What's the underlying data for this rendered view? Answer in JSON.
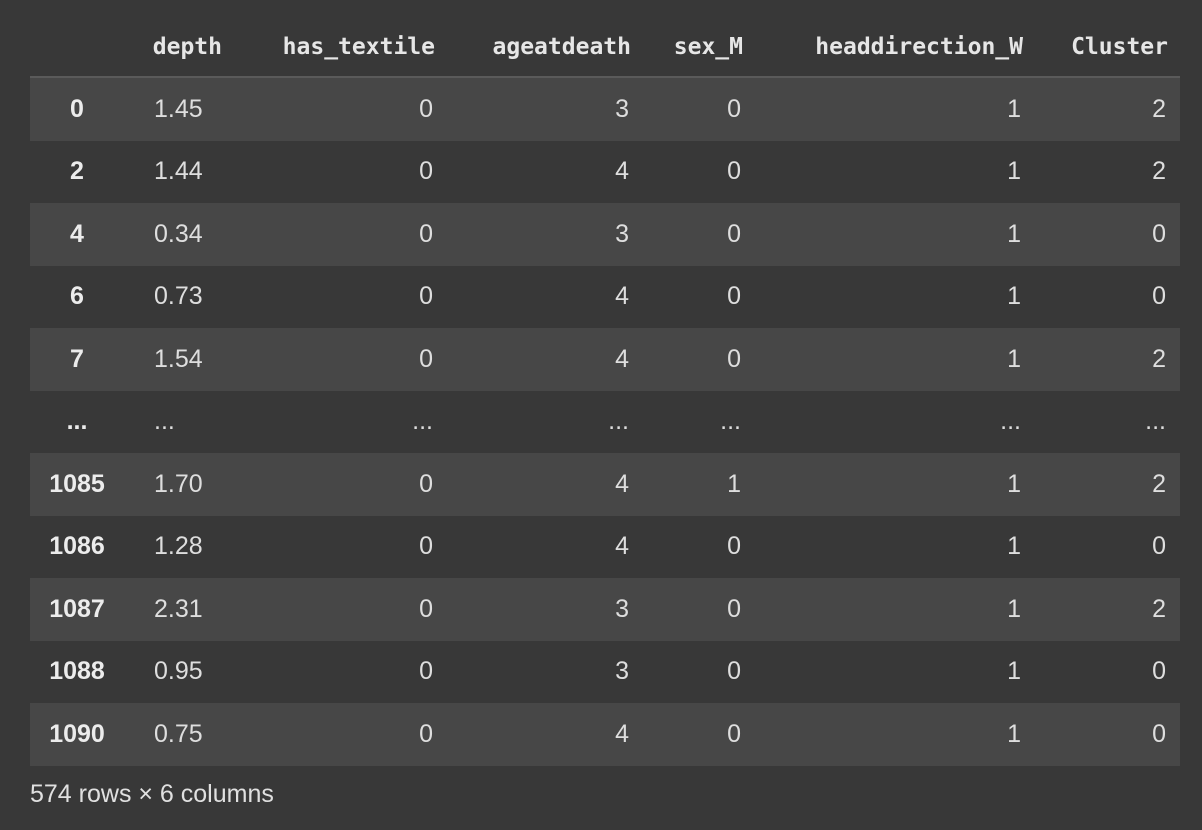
{
  "table": {
    "columns": [
      "depth",
      "has_textile",
      "ageatdeath",
      "sex_M",
      "headdirection_W",
      "Cluster"
    ],
    "rows": [
      {
        "index": "0",
        "cells": [
          "1.45",
          "0",
          "3",
          "0",
          "1",
          "2"
        ]
      },
      {
        "index": "2",
        "cells": [
          "1.44",
          "0",
          "4",
          "0",
          "1",
          "2"
        ]
      },
      {
        "index": "4",
        "cells": [
          "0.34",
          "0",
          "3",
          "0",
          "1",
          "0"
        ]
      },
      {
        "index": "6",
        "cells": [
          "0.73",
          "0",
          "4",
          "0",
          "1",
          "0"
        ]
      },
      {
        "index": "7",
        "cells": [
          "1.54",
          "0",
          "4",
          "0",
          "1",
          "2"
        ]
      },
      {
        "index": "...",
        "cells": [
          "...",
          "...",
          "...",
          "...",
          "...",
          "..."
        ]
      },
      {
        "index": "1085",
        "cells": [
          "1.70",
          "0",
          "4",
          "1",
          "1",
          "2"
        ]
      },
      {
        "index": "1086",
        "cells": [
          "1.28",
          "0",
          "4",
          "0",
          "1",
          "0"
        ]
      },
      {
        "index": "1087",
        "cells": [
          "2.31",
          "0",
          "3",
          "0",
          "1",
          "2"
        ]
      },
      {
        "index": "1088",
        "cells": [
          "0.95",
          "0",
          "3",
          "0",
          "1",
          "0"
        ]
      },
      {
        "index": "1090",
        "cells": [
          "0.75",
          "0",
          "4",
          "0",
          "1",
          "0"
        ]
      }
    ]
  },
  "footer": {
    "shape_text": "574 rows × 6 columns"
  }
}
